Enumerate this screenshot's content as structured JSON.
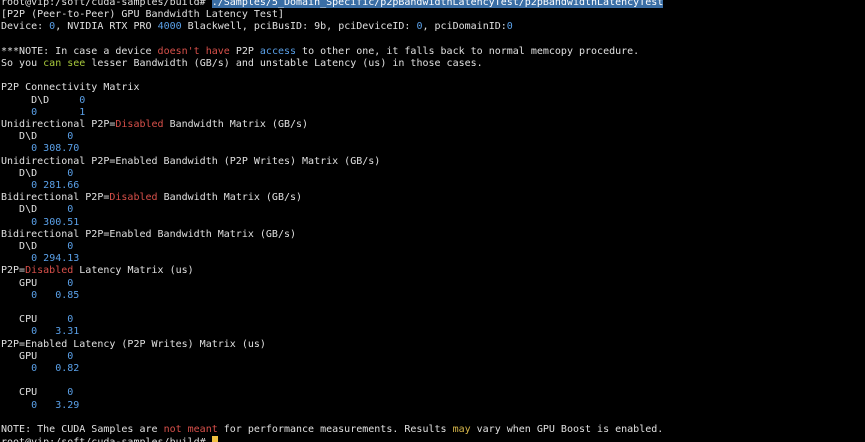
{
  "colors": {
    "background": "#000000",
    "text": "#e0e0e0",
    "red": "#d8504a",
    "blue": "#5aa0e8",
    "green": "#a8c93c",
    "yellow": "#d7b74a",
    "cursor": "#f0c040"
  },
  "lines": [
    [
      {
        "t": "root@vip:/soft/cuda-samples/build# "
      },
      {
        "t": "./Samples/5_Domain_Specific/p2pBandwidthLatencyTest/p2pBandwidthLatencyTest",
        "c": "sel"
      }
    ],
    [
      {
        "t": "[P2P (Peer-to-Peer) GPU Bandwidth Latency Test]"
      }
    ],
    [
      {
        "t": "Device: "
      },
      {
        "t": "0",
        "c": "num"
      },
      {
        "t": ", NVIDIA RTX PRO "
      },
      {
        "t": "4000",
        "c": "num"
      },
      {
        "t": " Blackwell, pciBusID: 9b, pciDeviceID: "
      },
      {
        "t": "0",
        "c": "num"
      },
      {
        "t": ", pciDomainID:"
      },
      {
        "t": "0",
        "c": "num"
      }
    ],
    [],
    [
      {
        "t": "***NOTE: In case a device "
      },
      {
        "t": "doesn't have",
        "c": "red"
      },
      {
        "t": " P2P "
      },
      {
        "t": "access",
        "c": "blue"
      },
      {
        "t": " to other one, it falls back to normal memcopy procedure."
      }
    ],
    [
      {
        "t": "So you "
      },
      {
        "t": "can see",
        "c": "green"
      },
      {
        "t": " lesser Bandwidth (GB/s) and unstable Latency (us) in those cases."
      }
    ],
    [],
    [
      {
        "t": "P2P Connectivity Matrix"
      }
    ],
    [
      {
        "t": "     D\\D     "
      },
      {
        "t": "0",
        "c": "num"
      }
    ],
    [
      {
        "t": "     "
      },
      {
        "t": "0",
        "c": "num"
      },
      {
        "t": "       "
      },
      {
        "t": "1",
        "c": "num"
      }
    ],
    [
      {
        "t": "Unidirectional P2P="
      },
      {
        "t": "Disabled",
        "c": "red"
      },
      {
        "t": " Bandwidth Matrix (GB/s)"
      }
    ],
    [
      {
        "t": "   D\\D     "
      },
      {
        "t": "0",
        "c": "num"
      }
    ],
    [
      {
        "t": "     "
      },
      {
        "t": "0",
        "c": "num"
      },
      {
        "t": " "
      },
      {
        "t": "308.70",
        "c": "num"
      }
    ],
    [
      {
        "t": "Unidirectional P2P=Enabled Bandwidth (P2P Writes) Matrix (GB/s)"
      }
    ],
    [
      {
        "t": "   D\\D     "
      },
      {
        "t": "0",
        "c": "num"
      }
    ],
    [
      {
        "t": "     "
      },
      {
        "t": "0",
        "c": "num"
      },
      {
        "t": " "
      },
      {
        "t": "281.66",
        "c": "num"
      }
    ],
    [
      {
        "t": "Bidirectional P2P="
      },
      {
        "t": "Disabled",
        "c": "red"
      },
      {
        "t": " Bandwidth Matrix (GB/s)"
      }
    ],
    [
      {
        "t": "   D\\D     "
      },
      {
        "t": "0",
        "c": "num"
      }
    ],
    [
      {
        "t": "     "
      },
      {
        "t": "0",
        "c": "num"
      },
      {
        "t": " "
      },
      {
        "t": "300.51",
        "c": "num"
      }
    ],
    [
      {
        "t": "Bidirectional P2P=Enabled Bandwidth Matrix (GB/s)"
      }
    ],
    [
      {
        "t": "   D\\D     "
      },
      {
        "t": "0",
        "c": "num"
      }
    ],
    [
      {
        "t": "     "
      },
      {
        "t": "0",
        "c": "num"
      },
      {
        "t": " "
      },
      {
        "t": "294.13",
        "c": "num"
      }
    ],
    [
      {
        "t": "P2P="
      },
      {
        "t": "Disabled",
        "c": "red"
      },
      {
        "t": " Latency Matrix (us)"
      }
    ],
    [
      {
        "t": "   GPU     "
      },
      {
        "t": "0",
        "c": "num"
      }
    ],
    [
      {
        "t": "     "
      },
      {
        "t": "0",
        "c": "num"
      },
      {
        "t": "   "
      },
      {
        "t": "0.85",
        "c": "num"
      }
    ],
    [],
    [
      {
        "t": "   CPU     "
      },
      {
        "t": "0",
        "c": "num"
      }
    ],
    [
      {
        "t": "     "
      },
      {
        "t": "0",
        "c": "num"
      },
      {
        "t": "   "
      },
      {
        "t": "3.31",
        "c": "num"
      }
    ],
    [
      {
        "t": "P2P=Enabled Latency (P2P Writes) Matrix (us)"
      }
    ],
    [
      {
        "t": "   GPU     "
      },
      {
        "t": "0",
        "c": "num"
      }
    ],
    [
      {
        "t": "     "
      },
      {
        "t": "0",
        "c": "num"
      },
      {
        "t": "   "
      },
      {
        "t": "0.82",
        "c": "num"
      }
    ],
    [],
    [
      {
        "t": "   CPU     "
      },
      {
        "t": "0",
        "c": "num"
      }
    ],
    [
      {
        "t": "     "
      },
      {
        "t": "0",
        "c": "num"
      },
      {
        "t": "   "
      },
      {
        "t": "3.29",
        "c": "num"
      }
    ],
    [],
    [
      {
        "t": "NOTE: The CUDA Samples are "
      },
      {
        "t": "not meant",
        "c": "red"
      },
      {
        "t": " for performance measurements. Results "
      },
      {
        "t": "may",
        "c": "yellow"
      },
      {
        "t": " vary when GPU Boost is enabled."
      }
    ],
    [
      {
        "t": "root@vip:/soft/cuda-samples/build# "
      }
    ]
  ]
}
